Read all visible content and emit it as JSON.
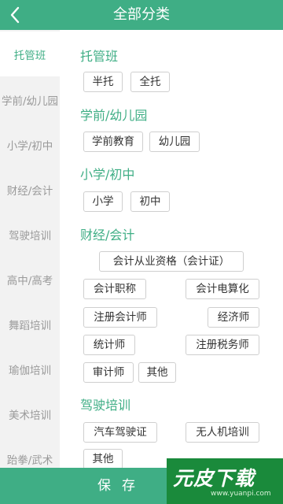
{
  "header": {
    "title": "全部分类"
  },
  "sidebar": {
    "items": [
      {
        "label": "托管班"
      },
      {
        "label": "学前/幼儿园"
      },
      {
        "label": "小学/初中"
      },
      {
        "label": "财经/会计"
      },
      {
        "label": "驾驶培训"
      },
      {
        "label": "高中/高考"
      },
      {
        "label": "舞蹈培训"
      },
      {
        "label": "瑜伽培训"
      },
      {
        "label": "美术培训"
      },
      {
        "label": "跆拳/武术"
      }
    ]
  },
  "content": {
    "sections": [
      {
        "title": "托管班",
        "tags": [
          "半托",
          "全托"
        ]
      },
      {
        "title": "学前/幼儿园",
        "tags": [
          "学前教育",
          "幼儿园"
        ]
      },
      {
        "title": "小学/初中",
        "tags": [
          "小学",
          "初中"
        ]
      },
      {
        "title": "财经/会计",
        "tags": [
          "会计从业资格（会计证）",
          "会计职称",
          "会计电算化",
          "注册会计师",
          "经济师",
          "统计师",
          "注册税务师",
          "审计师",
          "其他"
        ]
      },
      {
        "title": "驾驶培训",
        "tags": [
          "汽车驾驶证",
          "无人机培训",
          "其他"
        ]
      }
    ]
  },
  "footer": {
    "save_label": "保存"
  },
  "watermark": {
    "logo_text": "元皮下载",
    "url": "www.yuanpi.com"
  },
  "colors": {
    "accent": "#3fae85",
    "sidebar_bg": "#f2f2f2",
    "logo_bg": "#1a8a3b"
  }
}
